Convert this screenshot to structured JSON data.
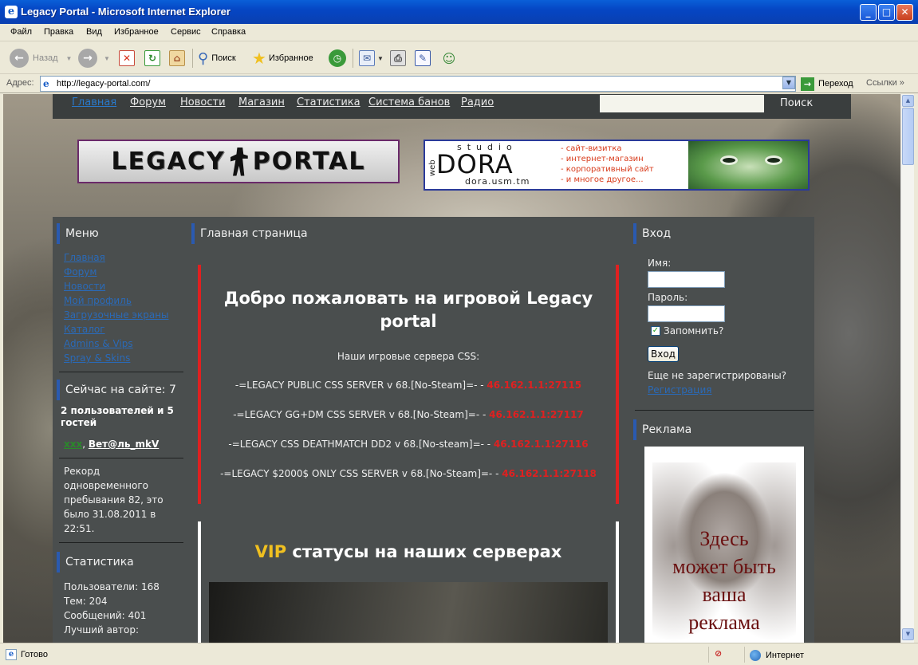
{
  "window": {
    "title": "Legacy Portal - Microsoft Internet Explorer"
  },
  "menubar": [
    "Файл",
    "Правка",
    "Вид",
    "Избранное",
    "Сервис",
    "Справка"
  ],
  "toolbar": {
    "back": "Назад",
    "search": "Поиск",
    "favorites": "Избранное"
  },
  "addressbar": {
    "label": "Адрес:",
    "url": "http://legacy-portal.com/",
    "go": "Переход",
    "links": "Ссылки"
  },
  "statusbar": {
    "status": "Готово",
    "zone": "Интернет"
  },
  "site": {
    "topnav": [
      "Главная",
      "Форум",
      "Новости",
      "Магазин",
      "Статистика",
      "Система банов",
      "Радио"
    ],
    "search_button": "Поиск",
    "logo_left": "LEGACY",
    "logo_right": "PORTAL",
    "banner": {
      "studio": "studio",
      "web": "web",
      "dora": "DORA",
      "site": "dora.usm.tm",
      "items": [
        "- сайт-визитка",
        "- интернет-магазин",
        "- корпоративный сайт",
        "- и многое другое..."
      ]
    },
    "left": {
      "menu_title": "Меню",
      "menu_items": [
        "Главная",
        "Форум",
        "Новости",
        "Мой профиль",
        "Загрузочные экраны",
        "Каталог",
        "Admins & Vips",
        "Spray & Skins"
      ],
      "online_title": "Сейчас на сайте: 7",
      "online_summary": "2 пользователей и 5 гостей",
      "online_user1": "xxx",
      "online_user2": "Вет@ль_mkV",
      "record": [
        "Рекорд",
        "одновременного",
        "пребывания 82, это",
        "было 31.08.2011 в",
        "22:51."
      ],
      "stats_title": "Статистика",
      "stats": [
        "Пользователи: 168",
        "Тем: 204",
        "Сообщений: 401",
        "Лучший автор:"
      ]
    },
    "center": {
      "title": "Главная страница",
      "welcome_line1": "Добро пожаловать на игровой Legacy",
      "welcome_line2": "portal",
      "servers_label": "Наши игровые сервера CSS:",
      "servers": [
        {
          "name": "-=LEGACY PUBLIC CSS SERVER v 68.[No-Steam]=- - ",
          "ip": "46.162.1.1:27115"
        },
        {
          "name": "-=LEGACY GG+DM CSS SERVER v 68.[No-Steam]=- - ",
          "ip": "46.162.1.1:27117"
        },
        {
          "name": "-=LEGACY CSS DEATHMATCH DD2 v 68.[No-steam]=- - ",
          "ip": "46.162.1.1:27116"
        },
        {
          "name": "-=LEGACY $2000$ ONLY CSS SERVER v 68.[No-Steam]=- - ",
          "ip": "46.162.1.1:27118"
        }
      ],
      "vip_word": "VIP",
      "vip_rest": " статусы на наших серверах"
    },
    "right": {
      "login_title": "Вход",
      "name_label": "Имя:",
      "password_label": "Пароль:",
      "remember": "Запомнить?",
      "login_button": "Вход",
      "not_registered": "Еще не зарегистрированы?",
      "register_link": "Регистрация",
      "ad_title": "Реклама",
      "ad_lines": [
        "Здесь",
        "может быть",
        "ваша",
        "реклама"
      ]
    }
  }
}
